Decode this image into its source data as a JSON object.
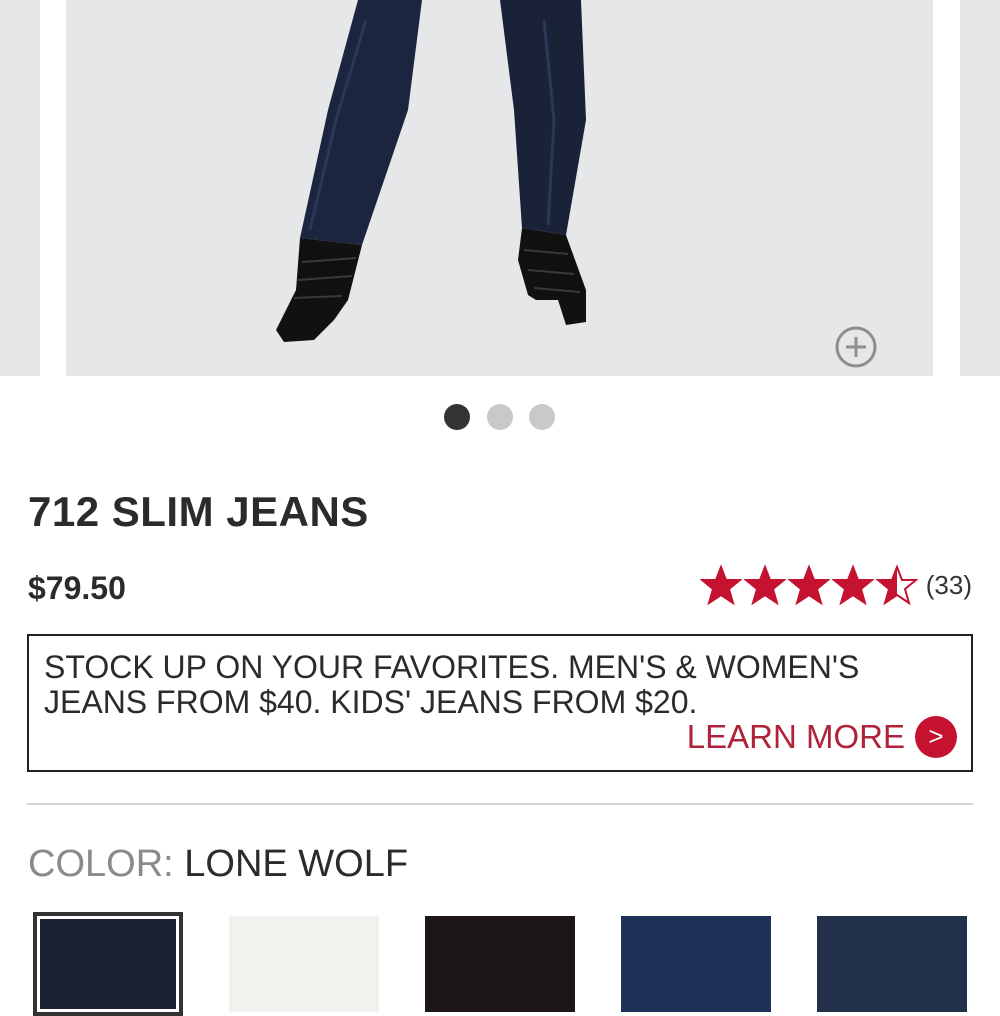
{
  "carousel": {
    "zoom_icon": "zoom-plus-icon",
    "slide_count": 3,
    "active_slide": 1
  },
  "product": {
    "title": "712 SLIM JEANS",
    "price": "$79.50",
    "rating": 4.5,
    "rating_max": 5,
    "review_count": "(33)"
  },
  "promo": {
    "text": "STOCK UP ON YOUR FAVORITES. MEN'S & WOMEN'S JEANS FROM $40. KIDS' JEANS FROM $20.",
    "link_label": "LEARN MORE",
    "link_icon": ">"
  },
  "color": {
    "label": "COLOR: ",
    "value": "LONE WOLF",
    "swatches": [
      {
        "name": "LONE WOLF",
        "color": "#1a2236",
        "selected": true
      },
      {
        "color": "#f2f1ee"
      },
      {
        "color": "#1d1616"
      },
      {
        "color": "#1e3157"
      },
      {
        "color": "#233049"
      }
    ]
  },
  "colors": {
    "accent": "#c41230",
    "star": "#c41230",
    "text": "#2b2b2b"
  }
}
